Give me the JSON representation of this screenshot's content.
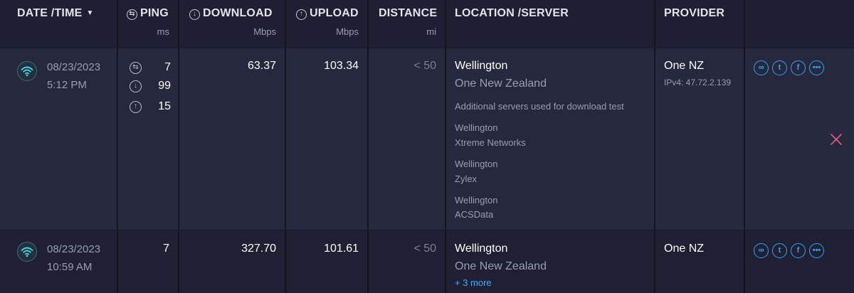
{
  "header": {
    "date_time": "DATE /TIME",
    "ping": "PING",
    "ping_unit": "ms",
    "download": "DOWNLOAD",
    "download_unit": "Mbps",
    "upload": "UPLOAD",
    "upload_unit": "Mbps",
    "distance": "DISTANCE",
    "distance_unit": "mi",
    "location": "LOCATION /SERVER",
    "provider": "PROVIDER"
  },
  "results": [
    {
      "date": "08/23/2023",
      "time": "5:12 PM",
      "ping_idle": "7",
      "ping_download": "99",
      "ping_upload": "15",
      "download": "63.37",
      "upload": "103.34",
      "distance": "< 50",
      "city": "Wellington",
      "sponsor": "One New Zealand",
      "additional_label": "Additional servers used for download test",
      "additional_servers": [
        {
          "city": "Wellington",
          "name": "Xtreme Networks"
        },
        {
          "city": "Wellington",
          "name": "Zylex"
        },
        {
          "city": "Wellington",
          "name": "ACSData"
        }
      ],
      "provider": "One NZ",
      "ip": "IPv4: 47.72.2.139"
    },
    {
      "date": "08/23/2023",
      "time": "10:59 AM",
      "ping": "7",
      "download": "327.70",
      "upload": "101.61",
      "distance": "< 50",
      "city": "Wellington",
      "sponsor": "One New Zealand",
      "more_link": "+ 3 more",
      "provider": "One NZ"
    }
  ],
  "icons": {
    "connection": "wifi-icon",
    "share": [
      "link-icon",
      "twitter-icon",
      "facebook-icon",
      "more-icon"
    ],
    "close": "close-icon"
  },
  "colors": {
    "accent": "#2fa3f0",
    "wifi": "#4fd1e0",
    "close": "#e0607a",
    "link": "#4aa8ff"
  }
}
